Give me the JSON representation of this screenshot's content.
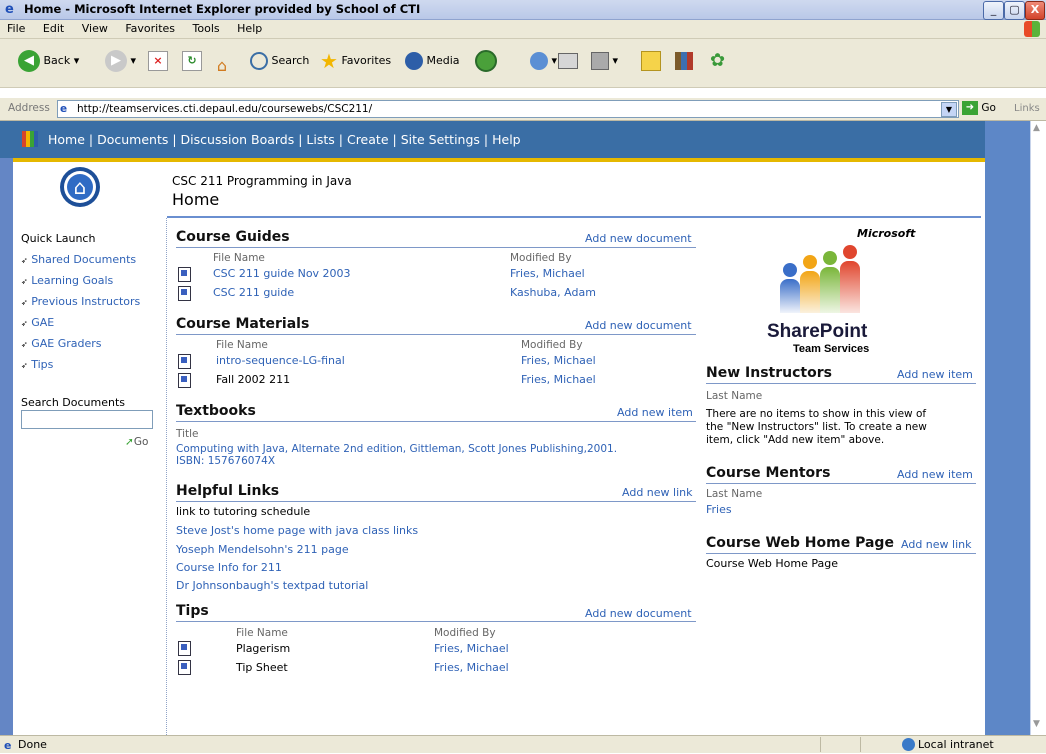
{
  "window": {
    "title": "Home - Microsoft Internet Explorer provided by School of CTI",
    "min_label": "_",
    "max_label": "▢",
    "close_label": "X"
  },
  "menu": [
    "File",
    "Edit",
    "View",
    "Favorites",
    "Tools",
    "Help"
  ],
  "toolbar": {
    "back": "Back",
    "search": "Search",
    "favorites": "Favorites",
    "media": "Media"
  },
  "address": {
    "label": "Address",
    "url": "http://teamservices.cti.depaul.edu/coursewebs/CSC211/",
    "go": "Go",
    "links": "Links"
  },
  "nav": {
    "items": [
      "Home",
      "Documents",
      "Discussion Boards",
      "Lists",
      "Create",
      "Site Settings",
      "Help"
    ]
  },
  "header": {
    "course": "CSC 211 Programming in Java",
    "page_title": "Home"
  },
  "quick_launch": {
    "title": "Quick Launch",
    "items": [
      "Shared Documents",
      "Learning Goals",
      "Previous Instructors",
      "GAE",
      "GAE Graders",
      "Tips"
    ],
    "search_title": "Search Documents",
    "go": "Go"
  },
  "course_guides": {
    "title": "Course Guides",
    "add": "Add new document",
    "col_file": "File Name",
    "col_mod": "Modified By",
    "rows": [
      {
        "file": "CSC 211 guide Nov 2003",
        "by": "Fries, Michael"
      },
      {
        "file": "CSC 211 guide",
        "by": "Kashuba, Adam"
      }
    ]
  },
  "course_materials": {
    "title": "Course Materials",
    "add": "Add new document",
    "col_file": "File Name",
    "col_mod": "Modified By",
    "rows": [
      {
        "file": "intro-sequence-LG-final",
        "by": "Fries, Michael"
      },
      {
        "file": "Fall 2002 211",
        "by": "Fries, Michael"
      }
    ]
  },
  "textbooks": {
    "title": "Textbooks",
    "add": "Add new item",
    "col_title": "Title",
    "item_line1": "Computing with Java, Alternate 2nd edition, Gittleman, Scott Jones Publishing,2001.",
    "item_line2": "ISBN: 157676074X"
  },
  "helpful_links": {
    "title": "Helpful Links",
    "add": "Add new link",
    "items": [
      "link to tutoring schedule",
      "Steve Jost's home page with java class links",
      "Yoseph Mendelsohn's 211 page",
      "Course Info for 211",
      "Dr Johnsonbaugh's textpad tutorial"
    ]
  },
  "tips": {
    "title": "Tips",
    "add": "Add new document",
    "col_file": "File Name",
    "col_mod": "Modified By",
    "rows": [
      {
        "file": "Plagerism",
        "by": "Fries, Michael"
      },
      {
        "file": "Tip Sheet",
        "by": "Fries, Michael"
      }
    ]
  },
  "logo": {
    "microsoft": "Microsoft",
    "sharepoint": "SharePoint",
    "team": "Team Services"
  },
  "new_instructors": {
    "title": "New Instructors",
    "add": "Add new item",
    "col": "Last Name",
    "empty1": "There are no items to show in this view of",
    "empty2": "the \"New Instructors\" list. To create a new",
    "empty3": "item, click \"Add new item\" above."
  },
  "course_mentors": {
    "title": "Course Mentors",
    "add": "Add new item",
    "col": "Last Name",
    "rows": [
      "Fries"
    ]
  },
  "course_web": {
    "title": "Course Web Home Page",
    "add": "Add new link",
    "item": "Course Web Home Page"
  },
  "status": {
    "left": "Done",
    "right": "Local intranet"
  },
  "colors": {
    "nav_blue": "#3a6ea5",
    "gold": "#e5b800",
    "link": "#2f62b6"
  }
}
